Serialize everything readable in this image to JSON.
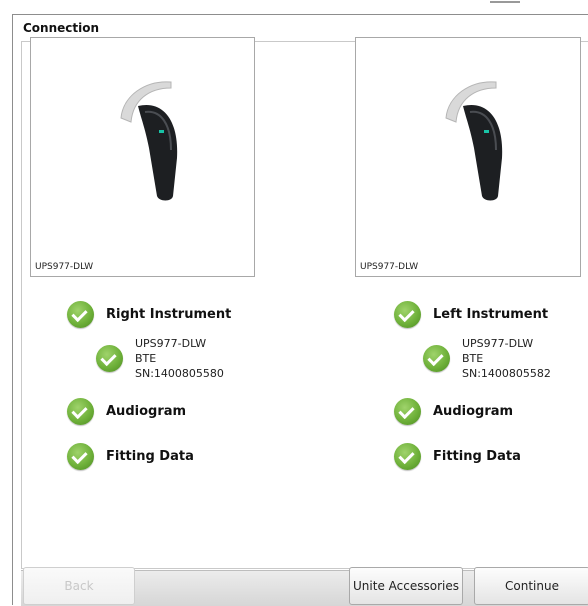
{
  "window": {
    "title": "Connection"
  },
  "right": {
    "image_caption": "UPS977-DLW",
    "instrument_label": "Right Instrument",
    "device": {
      "model": "UPS977-DLW",
      "type": "BTE",
      "serial": "SN:1400805580"
    },
    "audiogram_label": "Audiogram",
    "fitting_label": "Fitting Data"
  },
  "left": {
    "image_caption": "UPS977-DLW",
    "instrument_label": "Left Instrument",
    "device": {
      "model": "UPS977-DLW",
      "type": "BTE",
      "serial": "SN:1400805582"
    },
    "audiogram_label": "Audiogram",
    "fitting_label": "Fitting Data"
  },
  "buttons": {
    "back": "Back",
    "unite_accessories": "Unite Accessories",
    "continue": "Continue"
  },
  "colors": {
    "check_green": "#6fb13a",
    "device_body": "#1d1f22",
    "indicator_led": "#19c3a6"
  },
  "icons": {
    "status": "check-circle-icon",
    "device": "hearing-aid-icon"
  }
}
